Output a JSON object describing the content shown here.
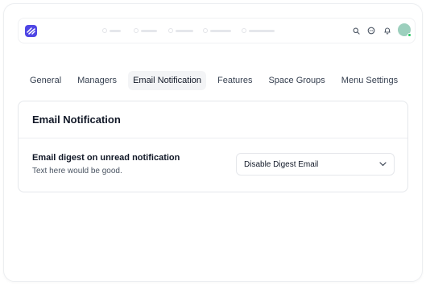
{
  "tabs": [
    {
      "label": "General"
    },
    {
      "label": "Managers"
    },
    {
      "label": "Email Notification"
    },
    {
      "label": "Features"
    },
    {
      "label": "Space Groups"
    },
    {
      "label": "Menu Settings"
    }
  ],
  "active_tab_index": 2,
  "card": {
    "title": "Email Notification",
    "setting_label": "Email digest on unread notification",
    "setting_help": "Text here would be good.",
    "select_value": "Disable Digest Email"
  },
  "icons": {
    "logo": "brand-logo-icon",
    "search": "search-icon",
    "chat": "chat-icon",
    "bell": "bell-icon",
    "avatar": "user-avatar",
    "select": "chevron-down-icon"
  },
  "colors": {
    "brand": "#4f46e5",
    "active_tab_bg": "#f3f4f6",
    "online_status": "#22c55e"
  }
}
